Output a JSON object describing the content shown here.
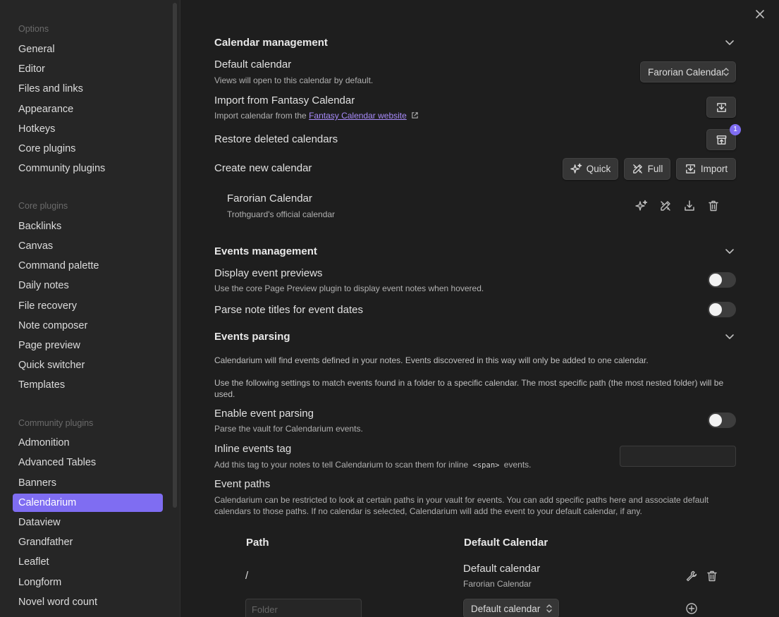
{
  "sidebar": {
    "sections": [
      {
        "title": "Options",
        "items": [
          "General",
          "Editor",
          "Files and links",
          "Appearance",
          "Hotkeys",
          "Core plugins",
          "Community plugins"
        ]
      },
      {
        "title": "Core plugins",
        "items": [
          "Backlinks",
          "Canvas",
          "Command palette",
          "Daily notes",
          "File recovery",
          "Note composer",
          "Page preview",
          "Quick switcher",
          "Templates"
        ]
      },
      {
        "title": "Community plugins",
        "items": [
          "Admonition",
          "Advanced Tables",
          "Banners",
          "Calendarium",
          "Dataview",
          "Grandfather",
          "Leaflet",
          "Longform",
          "Novel word count"
        ]
      }
    ],
    "active_item": "Calendarium"
  },
  "calendar_management": {
    "heading": "Calendar management",
    "default_calendar": {
      "name": "Default calendar",
      "desc": "Views will open to this calendar by default.",
      "value": "Farorian Calendar"
    },
    "import": {
      "name": "Import from Fantasy Calendar",
      "desc_prefix": "Import calendar from the ",
      "link": "Fantasy Calendar website"
    },
    "restore": {
      "name": "Restore deleted calendars",
      "badge": "1"
    },
    "create": {
      "name": "Create new calendar",
      "quick": "Quick",
      "full": "Full",
      "import": "Import"
    },
    "calendar_item": {
      "name": "Farorian Calendar",
      "desc": "Trothguard's official calendar"
    }
  },
  "events_management": {
    "heading": "Events management",
    "display_previews": {
      "name": "Display event previews",
      "desc": "Use the core Page Preview plugin to display event notes when hovered.",
      "enabled": false
    },
    "parse_titles": {
      "name": "Parse note titles for event dates",
      "enabled": false
    }
  },
  "events_parsing": {
    "heading": "Events parsing",
    "para1": "Calendarium will find events defined in your notes. Events discovered in this way will only be added to one calendar.",
    "para2": "Use the following settings to match events found in a folder to a specific calendar. The most specific path (the most nested folder) will be used.",
    "enable": {
      "name": "Enable event parsing",
      "desc": "Parse the vault for Calendarium events.",
      "enabled": false
    },
    "inline_tag": {
      "name": "Inline events tag",
      "desc_prefix": "Add this tag to your notes to tell Calendarium to scan them for inline ",
      "code": "<span>",
      "desc_suffix": " events.",
      "value": ""
    },
    "event_paths": {
      "name": "Event paths",
      "desc": "Calendarium can be restricted to look at certain paths in your vault for events. You can add specific paths here and associate default calendars to those paths. If no calendar is selected, Calendarium will add the event to your default calendar, if any."
    },
    "table": {
      "col_path": "Path",
      "col_calendar": "Default Calendar",
      "rows": [
        {
          "path": "/",
          "calendar_label": "Default calendar",
          "calendar_value": "Farorian Calendar"
        }
      ],
      "new_row": {
        "folder_placeholder": "Folder",
        "calendar_select": "Default calendar"
      }
    }
  },
  "colors": {
    "accent": "#7f6df2",
    "link": "#a88bfa"
  }
}
